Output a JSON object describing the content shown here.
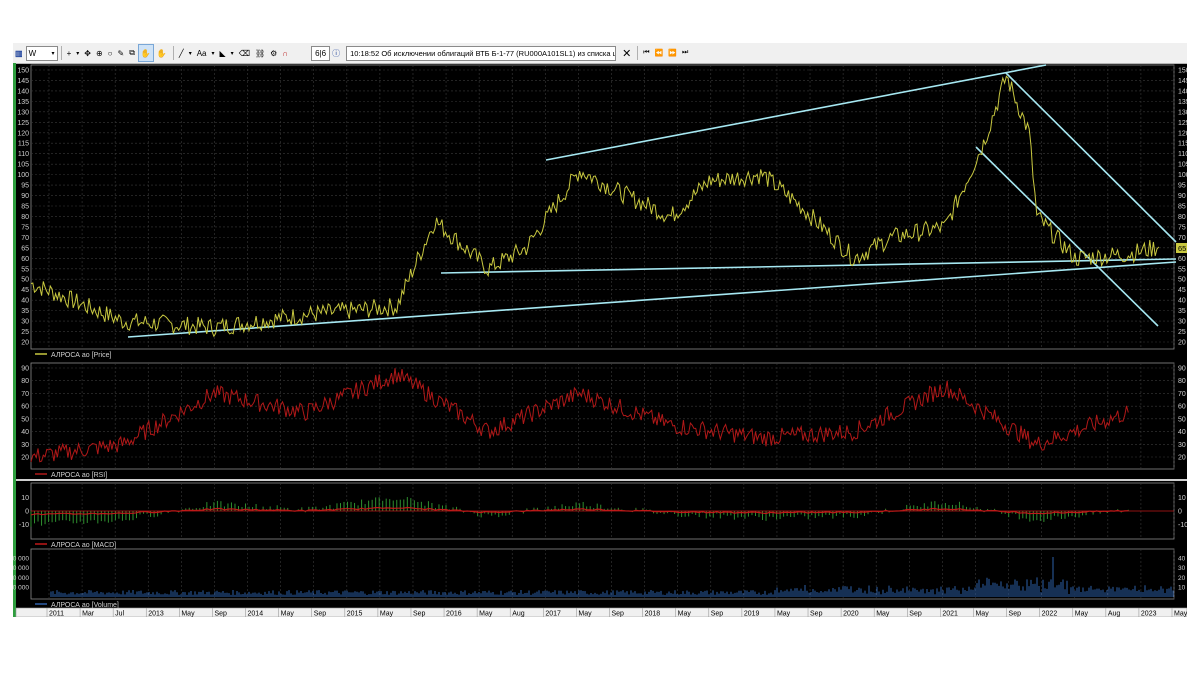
{
  "toolbar": {
    "interval": "W",
    "counter": "6|6",
    "news": "10:18:52  Об исключении облигаций ВТБ Б-1-77 (RU000A101SL1) из списка цен"
  },
  "colors": {
    "background": "#000000",
    "price_line": "#c8c840",
    "trend_lines": "#a6e8f2",
    "rsi_line": "#b01818",
    "macd_line": "#c01818",
    "macd_histogram": "#2f8f2f",
    "volume_bars": "#2d5fa8",
    "price_label_bg": "#c8c840"
  },
  "panels": {
    "price": {
      "legend": "АЛРОСА ао [Price]",
      "y_ticks": [
        "150",
        "145",
        "140",
        "135",
        "130",
        "125",
        "120",
        "115",
        "110",
        "105",
        "100",
        "95",
        "90",
        "85",
        "80",
        "75",
        "70",
        "65",
        "60",
        "55",
        "50",
        "45",
        "40",
        "35",
        "30",
        "25",
        "20"
      ],
      "last_value": "65.45"
    },
    "rsi": {
      "legend": "АЛРОСА ао [RSI]",
      "y_ticks": [
        "90",
        "80",
        "70",
        "60",
        "50",
        "40",
        "30",
        "20"
      ]
    },
    "macd": {
      "legend": "АЛРОСА ао [MACD]",
      "y_ticks": [
        "10",
        "0",
        "-10"
      ]
    },
    "volume": {
      "legend": "АЛРОСА ао [Volume]",
      "y_ticks": [
        "40 000",
        "30 000",
        "20 000",
        "10 000"
      ]
    }
  },
  "time_axis": [
    "2011",
    "Mar",
    "Jul",
    "2013",
    "May",
    "Sep",
    "2014",
    "May",
    "Sep",
    "2015",
    "May",
    "Sep",
    "2016",
    "May",
    "Aug",
    "2017",
    "May",
    "Sep",
    "2018",
    "May",
    "Sep",
    "2019",
    "May",
    "Sep",
    "2020",
    "May",
    "Sep",
    "2021",
    "May",
    "Sep",
    "2022",
    "May",
    "Aug",
    "2023",
    "May"
  ],
  "chart_data": {
    "type": "line",
    "series": [
      {
        "name": "АЛРОСА ао [Price]",
        "x": [
          "2011",
          "2012",
          "2013",
          "2014",
          "2015",
          "2015-06",
          "2016",
          "2016-06",
          "2017",
          "2017-06",
          "2018",
          "2018-06",
          "2019",
          "2019-06",
          "2020",
          "2020-06",
          "2021",
          "2021-06",
          "2021-09",
          "2021-12",
          "2022",
          "2022-06",
          "2023",
          "2023-05"
        ],
        "values": [
          48,
          30,
          27,
          33,
          37,
          78,
          55,
          65,
          102,
          92,
          80,
          97,
          100,
          85,
          60,
          70,
          75,
          115,
          147,
          120,
          80,
          60,
          62,
          65.45
        ]
      },
      {
        "name": "АЛРОСА ао [RSI]",
        "x": [
          "2011",
          "2012",
          "2013",
          "2014",
          "2015",
          "2016",
          "2017",
          "2018",
          "2019",
          "2020",
          "2021",
          "2022",
          "2023"
        ],
        "values": [
          20,
          30,
          70,
          55,
          85,
          40,
          70,
          45,
          35,
          40,
          75,
          30,
          55
        ]
      }
    ]
  }
}
